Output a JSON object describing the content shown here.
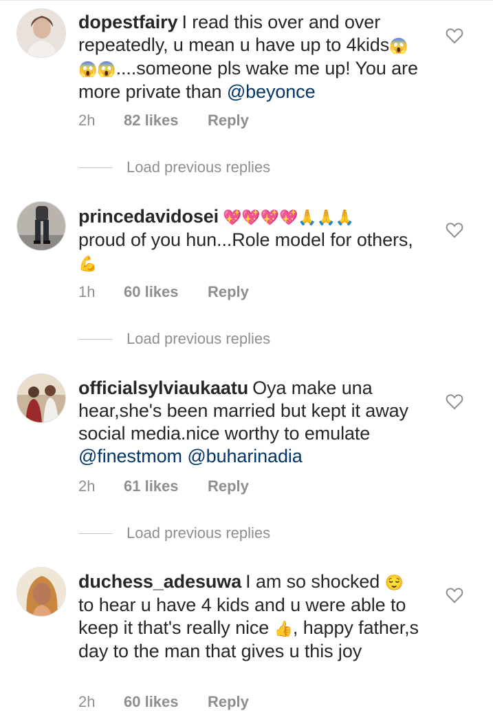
{
  "comments": [
    {
      "username": "dopestfairy",
      "text_parts": [
        "I read this over and over repeatedly, u mean u have up to 4kids",
        "😱😱😱",
        "....someone pls wake me up! You are more private than "
      ],
      "mention": "@beyonce",
      "time": "2h",
      "likes": "82 likes",
      "reply": "Reply"
    },
    {
      "username": "princedavidosei",
      "emojis_1": "💖💖💖💖🙏🙏🙏",
      "text": "proud of you hun...Role model for others,",
      "emojis_2": "💪",
      "time": "1h",
      "likes": "60 likes",
      "reply": "Reply"
    },
    {
      "username": "officialsylviaukaatu",
      "text": "Oya make una hear,she's been married but kept it away social media.nice worthy to emulate",
      "mention_1": "@finestmom",
      "mention_2": "@buharinadia",
      "time": "2h",
      "likes": "61 likes",
      "reply": "Reply"
    },
    {
      "username": "duchess_adesuwa",
      "text_1": "I am so shocked",
      "emoji_1": "😌",
      "text_2": "to hear u have 4 kids and u were able to keep it that's really nice",
      "emoji_2": "👍",
      "text_3": ", happy father,s day to the man that gives u this joy",
      "time": "2h",
      "likes": "60 likes",
      "reply": "Reply"
    }
  ],
  "load_previous_replies": "Load previous replies",
  "icons": {
    "like": "heart-outline-icon"
  },
  "colors": {
    "mention": "#003569",
    "meta": "#8e8e8e",
    "text": "#262626"
  }
}
